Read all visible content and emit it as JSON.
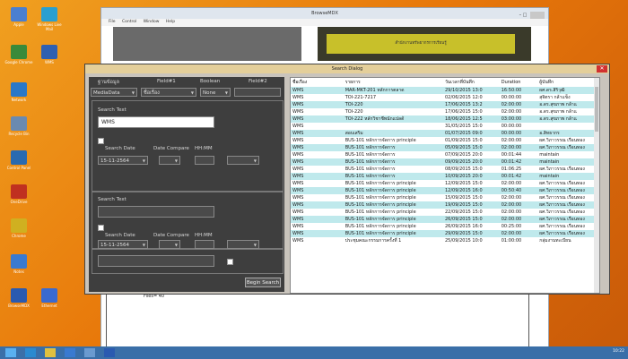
{
  "desktop": {
    "icons": [
      {
        "label": "Apple",
        "color": "#4a7fd0"
      },
      {
        "label": "Windows Live Mail",
        "color": "#2a9fd0"
      },
      {
        "label": "Google Chrome",
        "color": "#3a8a3a"
      },
      {
        "label": "WMS",
        "color": "#3060b0"
      },
      {
        "label": "Network",
        "color": "#2a78c8"
      },
      {
        "label": "Recycle Bin",
        "color": "#6a8ab0"
      },
      {
        "label": "Control Panel",
        "color": "#2a6ab0"
      },
      {
        "label": "OneDrive",
        "color": "#c03020"
      },
      {
        "label": "Chrome",
        "color": "#d0b020"
      },
      {
        "label": "Notes",
        "color": "#3a7ad0"
      },
      {
        "label": "BrowseMDX",
        "color": "#2a5ab0"
      },
      {
        "label": "Ethernet",
        "color": "#3a6ad0"
      }
    ]
  },
  "main_window": {
    "title": "BrowseMDX",
    "menu": [
      "File",
      "Control",
      "Window",
      "Help"
    ],
    "banner": "สำนักงานทรัพยากรการเรียนรู้"
  },
  "dialog": {
    "title": "Search Dialog",
    "close": "✕",
    "headers": {
      "db": "ฐานข้อมูล",
      "field1": "Field#1",
      "boolean": "Boolean",
      "field2": "Field#2"
    },
    "db_value": "MediaData",
    "field1_value": "ชื่อเรื่อง",
    "boolean_value": "None",
    "field2_value": "",
    "group1_label": "Search Text",
    "search_text_1": "WMS",
    "search_date_label": "Search Date",
    "date_compare_label": "Date Compare",
    "hhmm_label": "HH:MM",
    "date_value_1": "15-11-2564",
    "date_value_2": "15-11-2564",
    "group2_label": "Search Text",
    "search_text_2": "",
    "search_text_3": "",
    "begin_search": "Begin Search",
    "status": "Files= 40",
    "results_headers": [
      "ชื่อเรื่อง",
      "รายการ",
      "วันเวลาที่บันทึก",
      "Duration",
      "ผู้บันทึก"
    ],
    "results": [
      [
        "WMS",
        "MAR-MKT-201 หลักการตลาด",
        "29/10/2015 13:0",
        "16:50:00",
        "ผศ.ดร.สิริวุฒิ"
      ],
      [
        "WMS",
        "TOI-221-7217",
        "02/06/2015 12:0",
        "00:00:00",
        "สุจิตรา กล้าแข็ง"
      ],
      [
        "WMS",
        "TOI-220",
        "17/06/2015 13:2",
        "02:00:00",
        "อ.ดร.สุขภาพ กล้าแ"
      ],
      [
        "WMS",
        "TOI-220",
        "17/06/2015 15:0",
        "02:00:00",
        "อ.ดร.สุขภาพ กล้าแ"
      ],
      [
        "WMS",
        "TOI-222 หลักวิชาชีพนักแปลด้",
        "18/06/2015 12:5",
        "03:00:00",
        "อ.ดร.สุขภาพ กล้าแ"
      ],
      [
        "WMS",
        "",
        "31/05/2015 15:0",
        "00:00:00",
        ""
      ],
      [
        "WMS",
        "สอบเสริม",
        "01/07/2015 09:0",
        "00:00:00",
        "อ.สิทธากร"
      ],
      [
        "WMS",
        "BUS-101 หลักการจัดการ principle",
        "01/09/2015 15:0",
        "02:00:00",
        "ผศ.วิภาวรรณ เรือนทอง"
      ],
      [
        "WMS",
        "BUS-101 หลักการจัดการ",
        "05/09/2015 15:0",
        "02:00:00",
        "ผศ.วิภาวรรณ เรือนทอง"
      ],
      [
        "WMS",
        "BUS-101 หลักการจัดการ",
        "07/09/2015 20:0",
        "00:01:44",
        "maintain"
      ],
      [
        "WMS",
        "BUS-101 หลักการจัดการ",
        "09/09/2015 20:0",
        "00:01:42",
        "maintain"
      ],
      [
        "WMS",
        "BUS-101 หลักการจัดการ",
        "08/09/2015 15:0",
        "01:06:25",
        "ผศ.วิภาวรรณ เรือนทอง"
      ],
      [
        "WMS",
        "BUS-101 หลักการจัดการ",
        "10/09/2015 20:0",
        "00:01:42",
        "maintain"
      ],
      [
        "WMS",
        "BUS-101 หลักการจัดการ principle",
        "12/09/2015 15:0",
        "02:00:00",
        "ผศ.วิภาวรรณ เรือนทอง"
      ],
      [
        "WMS",
        "BUS-101 หลักการจัดการ principle",
        "12/09/2015 16:0",
        "00:50:40",
        "ผศ.วิภาวรรณ เรือนทอง"
      ],
      [
        "WMS",
        "BUS-101 หลักการจัดการ principle",
        "15/09/2015 15:0",
        "02:00:00",
        "ผศ.วิภาวรรณ เรือนทอง"
      ],
      [
        "WMS",
        "BUS-101 หลักการจัดการ principle",
        "19/09/2015 15:0",
        "02:00:00",
        "ผศ.วิภาวรรณ เรือนทอง"
      ],
      [
        "WMS",
        "BUS-101 หลักการจัดการ principle",
        "22/09/2015 15:0",
        "02:00:00",
        "ผศ.วิภาวรรณ เรือนทอง"
      ],
      [
        "WMS",
        "BUS-101 หลักการจัดการ principle",
        "26/09/2015 15:0",
        "02:00:00",
        "ผศ.วิภาวรรณ เรือนทอง"
      ],
      [
        "WMS",
        "BUS-101 หลักการจัดการ principle",
        "26/09/2015 16:0",
        "00:25:00",
        "ผศ.วิภาวรรณ เรือนทอง"
      ],
      [
        "WMS",
        "BUS-101 หลักการจัดการ principle",
        "29/09/2015 15:0",
        "02:00:00",
        "ผศ.วิภาวรรณ เรือนทอง"
      ],
      [
        "WMS",
        "ประชุมคณะกรรมการครั้งที่ 1",
        "25/09/2015 10:0",
        "01:00:00",
        "กลุ่มงานทะเบียน"
      ]
    ]
  },
  "taskbar": {
    "clock": "10:22"
  }
}
